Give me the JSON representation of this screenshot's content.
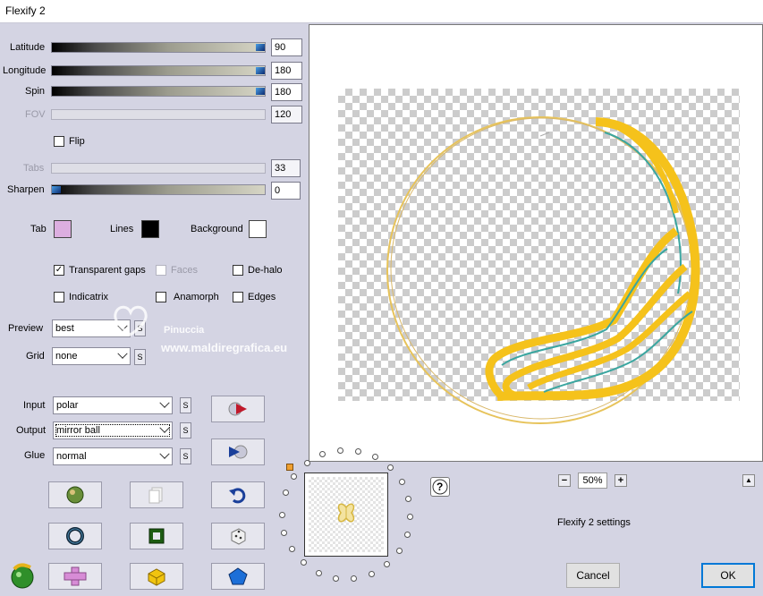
{
  "window": {
    "title": "Flexify 2"
  },
  "sliders": [
    {
      "label": "Latitude",
      "value": "90",
      "level": 1.0,
      "enabled": true
    },
    {
      "label": "Longitude",
      "value": "180",
      "level": 1.0,
      "enabled": true
    },
    {
      "label": "Spin",
      "value": "180",
      "level": 1.0,
      "enabled": true
    },
    {
      "label": "FOV",
      "value": "120",
      "level": 0.0,
      "enabled": false
    },
    {
      "label": "Tabs",
      "value": "33",
      "level": 0.0,
      "enabled": false
    },
    {
      "label": "Sharpen",
      "value": "0",
      "level": 0.0,
      "enabled": true
    }
  ],
  "flip": {
    "label": "Flip",
    "checked": false
  },
  "colors": {
    "tab": {
      "label": "Tab",
      "color": "#dcaee0"
    },
    "lines": {
      "label": "Lines",
      "color": "#000000"
    },
    "background": {
      "label": "Background",
      "color": "#ffffff"
    }
  },
  "options": {
    "transparent_gaps": {
      "label": "Transparent gaps",
      "checked": true
    },
    "faces": {
      "label": "Faces",
      "checked": false,
      "enabled": false
    },
    "de_halo": {
      "label": "De-halo",
      "checked": false
    },
    "indicatrix": {
      "label": "Indicatrix",
      "checked": false
    },
    "anamorph": {
      "label": "Anamorph",
      "checked": false
    },
    "edges": {
      "label": "Edges",
      "checked": false
    }
  },
  "preview_select": {
    "label": "Preview",
    "value": "best"
  },
  "grid_select": {
    "label": "Grid",
    "value": "none"
  },
  "input_select": {
    "label": "Input",
    "value": "polar"
  },
  "output_select": {
    "label": "Output",
    "value": "mirror ball"
  },
  "glue_select": {
    "label": "Glue",
    "value": "normal"
  },
  "s_label": "S",
  "watermark": {
    "name": "Pinuccia",
    "url": "www.maldiregrafica.eu"
  },
  "zoom": {
    "minus": "−",
    "value": "50%",
    "plus": "+"
  },
  "help_label": "?",
  "collapse_label": "▲",
  "status": "Flexify 2 settings",
  "buttons": {
    "cancel": "Cancel",
    "ok": "OK"
  },
  "accent": {
    "ring": "#f5c21b",
    "ring_edge": "#3aa6a0",
    "knob": "#1b4aa0"
  }
}
